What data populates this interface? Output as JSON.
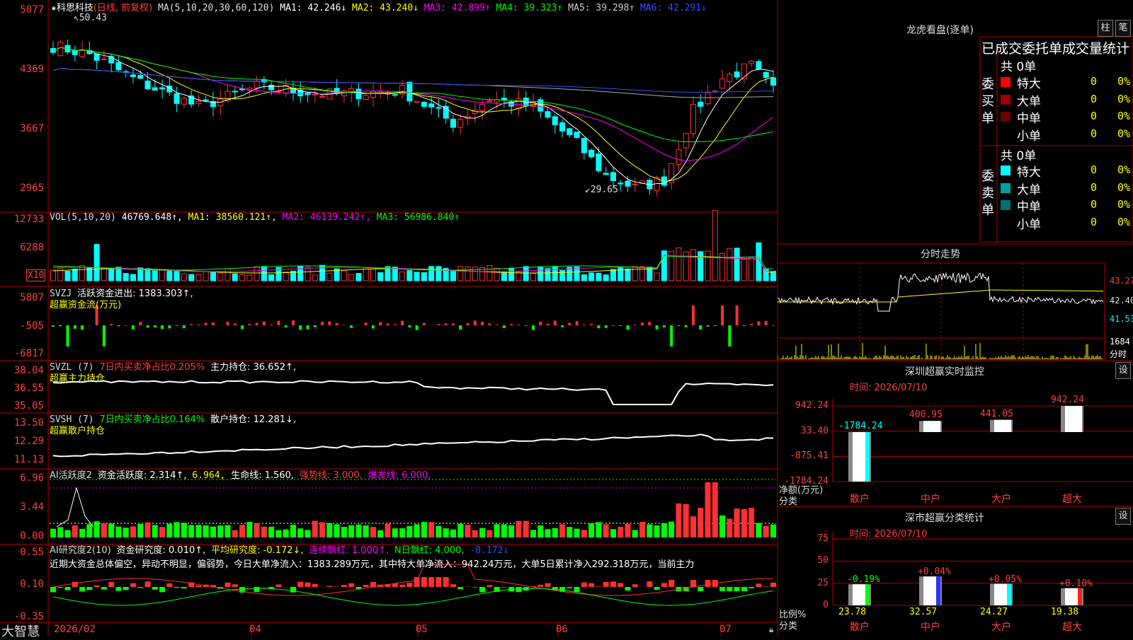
{
  "main": {
    "title_star": "★",
    "stock_name": "科思科技",
    "period": "(日线, 前复权)",
    "ma_params": "MA(5,10,20,30,60,120)",
    "ma": [
      {
        "label": "MA1: 42.246↓",
        "color": "#ffffff"
      },
      {
        "label": "MA2: 43.240↓",
        "color": "#ffff00"
      },
      {
        "label": "MA3: 42.899↑",
        "color": "#ff00ff"
      },
      {
        "label": "MA4: 39.323↑",
        "color": "#00ff00"
      },
      {
        "label": "MA5: 39.298↑",
        "color": "#cccccc"
      },
      {
        "label": "MA6: 42.291↓",
        "color": "#3050ff"
      }
    ],
    "y_ticks": [
      "5077",
      "4369",
      "3667",
      "2965"
    ],
    "high_label": "50.43",
    "low_label": "29.65"
  },
  "vol": {
    "params": "VOL(5,10,20)",
    "value": "46769.648↑,",
    "ma1": "MA1: 38560.121↑,",
    "ma2": "MA2: 46139.242↑,",
    "ma3": "MA3: 56986.840↑",
    "y_ticks": [
      "12733",
      "6288"
    ],
    "unit": "X10"
  },
  "svzj": {
    "name": "SVZJ",
    "text": "活跃资金进出: 1383.303↑,",
    "subtitle": "超赢资金流(万元)",
    "y_ticks": [
      "5807",
      "-505",
      "-6817"
    ]
  },
  "svzl": {
    "name": "SVZL (7)",
    "ratio": "7日内买卖净占比0.205%",
    "hold": "主力持仓: 36.652↑,",
    "subtitle": "超赢主力持仓",
    "y_ticks": [
      "38.04",
      "36.55",
      "35.05"
    ]
  },
  "svsh": {
    "name": "SVSH (7)",
    "ratio": "7日内买卖净占比0.164%",
    "hold": "散户持仓: 12.281↓,",
    "subtitle": "超赢散户持仓",
    "y_ticks": [
      "13.50",
      "12.29",
      "11.13"
    ]
  },
  "ai_active": {
    "name": "AI活跃度2",
    "active": "资金活跃度: 2.314↑,",
    "v2": "6.964,",
    "life": "生命线: 1.560,",
    "strong": "强势线: 3.000,",
    "burst": "爆发线: 6.000,",
    "y_ticks": [
      "6.96",
      "3.44",
      "0.00"
    ]
  },
  "ai_research": {
    "name": "AI研究度2(10)",
    "research": "资金研究度: 0.010↑,",
    "avg": "平均研究度: -0.172↓,",
    "streak": "连续飘红: 1.000↑,",
    "nday": "N日飘红: 4.000,",
    "last": "-0.172↓",
    "comment": "近期大资金总体偏空，异动不明显，偏弱势，今日大单净流入：1383.289万元，其中特大单净流入：942.24万元，大单5日累计净入292.318万元，当前主力",
    "y_ticks": [
      "0.55",
      "0.10",
      "-0.35"
    ]
  },
  "x_axis": {
    "brand": "大智慧",
    "labels": [
      "2026/02",
      "04",
      "05",
      "06",
      "07"
    ]
  },
  "longhu": {
    "title": "龙虎看盘(逐单)",
    "btn1": "柱",
    "btn2": "笔",
    "header": "已成交委托单成交量统计",
    "buy_side": "委买单",
    "sell_side": "委卖单",
    "buy_total": "共 0单",
    "sell_total": "共 0单",
    "buy_rows": [
      {
        "name": "特大",
        "count": "0",
        "pct": "0%",
        "color": "#ff0000"
      },
      {
        "name": "大单",
        "count": "0",
        "pct": "0%",
        "color": "#a00000"
      },
      {
        "name": "中单",
        "count": "0",
        "pct": "0%",
        "color": "#700000"
      },
      {
        "name": "小单",
        "count": "0",
        "pct": "0%",
        "color": "#000000"
      }
    ],
    "sell_rows": [
      {
        "name": "特大",
        "count": "0",
        "pct": "0%",
        "color": "#00ffff"
      },
      {
        "name": "大单",
        "count": "0",
        "pct": "0%",
        "color": "#00a0a0"
      },
      {
        "name": "中单",
        "count": "0",
        "pct": "0%",
        "color": "#007070"
      },
      {
        "name": "小单",
        "count": "0",
        "pct": "0%",
        "color": "#000000"
      }
    ]
  },
  "intraday": {
    "title": "分时走势",
    "price_ticks": [
      "43.27",
      "42.40",
      "41.53"
    ],
    "vol_tick": "1684",
    "vol_unit": "分时"
  },
  "sz_monitor": {
    "title": "深圳超赢实时监控",
    "set": "设",
    "time": "时间: 2026/07/10",
    "y_ticks": [
      "942.24",
      "33.40",
      "-875.41",
      "-1784.24"
    ],
    "y_label": "净额(万元)",
    "x_label": "分类",
    "bars": [
      {
        "name": "散户",
        "value": -1784.24,
        "label": "-1784.24",
        "color": "#00ffff"
      },
      {
        "name": "中户",
        "value": 400.95,
        "label": "400.95",
        "color": "#ffffff"
      },
      {
        "name": "大户",
        "value": 441.05,
        "label": "441.05",
        "color": "#ffffff"
      },
      {
        "name": "超大",
        "value": 942.24,
        "label": "942.24",
        "color": "#ffffff"
      }
    ]
  },
  "sz_stats": {
    "title": "深市超赢分类统计",
    "set": "设",
    "time": "时间: 2026/07/10",
    "y_ticks": [
      "75",
      "50",
      "25",
      "0"
    ],
    "y_label": "比例%",
    "x_label": "分类",
    "bars": [
      {
        "name": "散户",
        "value": 23.78,
        "label": "23.78",
        "delta": "-0.19%",
        "color": "#00ff00"
      },
      {
        "name": "中户",
        "value": 32.57,
        "label": "32.57",
        "delta": "+0.04%",
        "color": "#3030ff"
      },
      {
        "name": "大户",
        "value": 24.27,
        "label": "24.27",
        "delta": "+0.05%",
        "color": "#00ffff"
      },
      {
        "name": "超大",
        "value": 19.38,
        "label": "19.38",
        "delta": "+0.10%",
        "color": "#ff2020"
      }
    ]
  },
  "colors": {
    "up": "#ff3030",
    "down": "#00ffff",
    "grid": "#b00000",
    "green": "#00ff00"
  }
}
